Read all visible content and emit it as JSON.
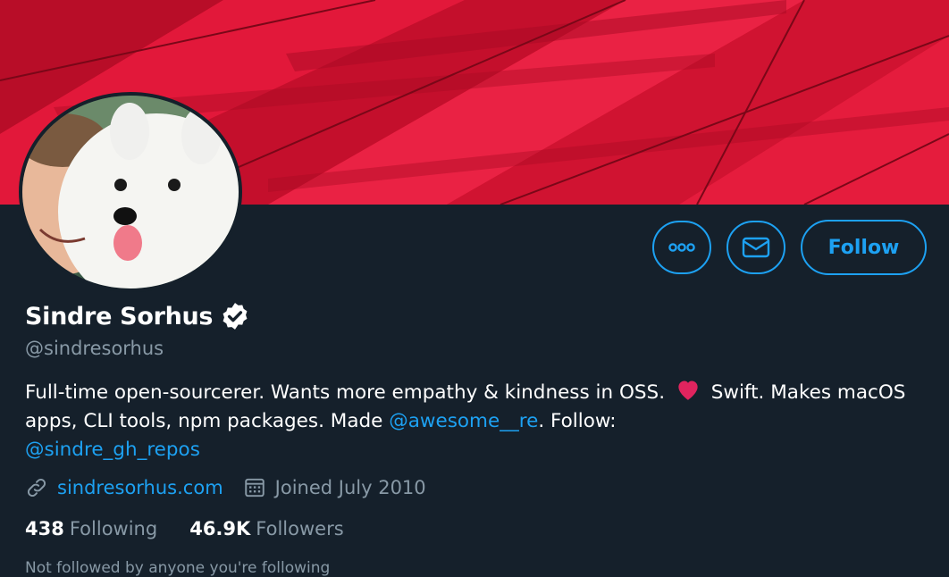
{
  "profile": {
    "name": "Sindre Sorhus",
    "handle": "@sindresorhus",
    "bio": {
      "part1": "Full-time open-sourcerer. Wants more empathy & kindness in OSS.",
      "part2": "Swift. Makes macOS apps, CLI tools, npm packages. Made",
      "mention1": "@awesome__re",
      "part3": ". Follow:",
      "mention2": "@sindre_gh_repos"
    },
    "website": "sindresorhus.com",
    "joined": "Joined July 2010",
    "following_count": "438",
    "following_label": "Following",
    "followers_count": "46.9K",
    "followers_label": "Followers",
    "cutoff_text": "Not followed by anyone you're following"
  },
  "actions": {
    "follow_label": "Follow",
    "more_icon": "more-icon",
    "message_icon": "mail-icon"
  },
  "colors": {
    "background": "#15202b",
    "accent": "#1da1f2",
    "secondary_text": "#8899a6",
    "banner": "#c8102e",
    "heart": "#e0245e"
  }
}
